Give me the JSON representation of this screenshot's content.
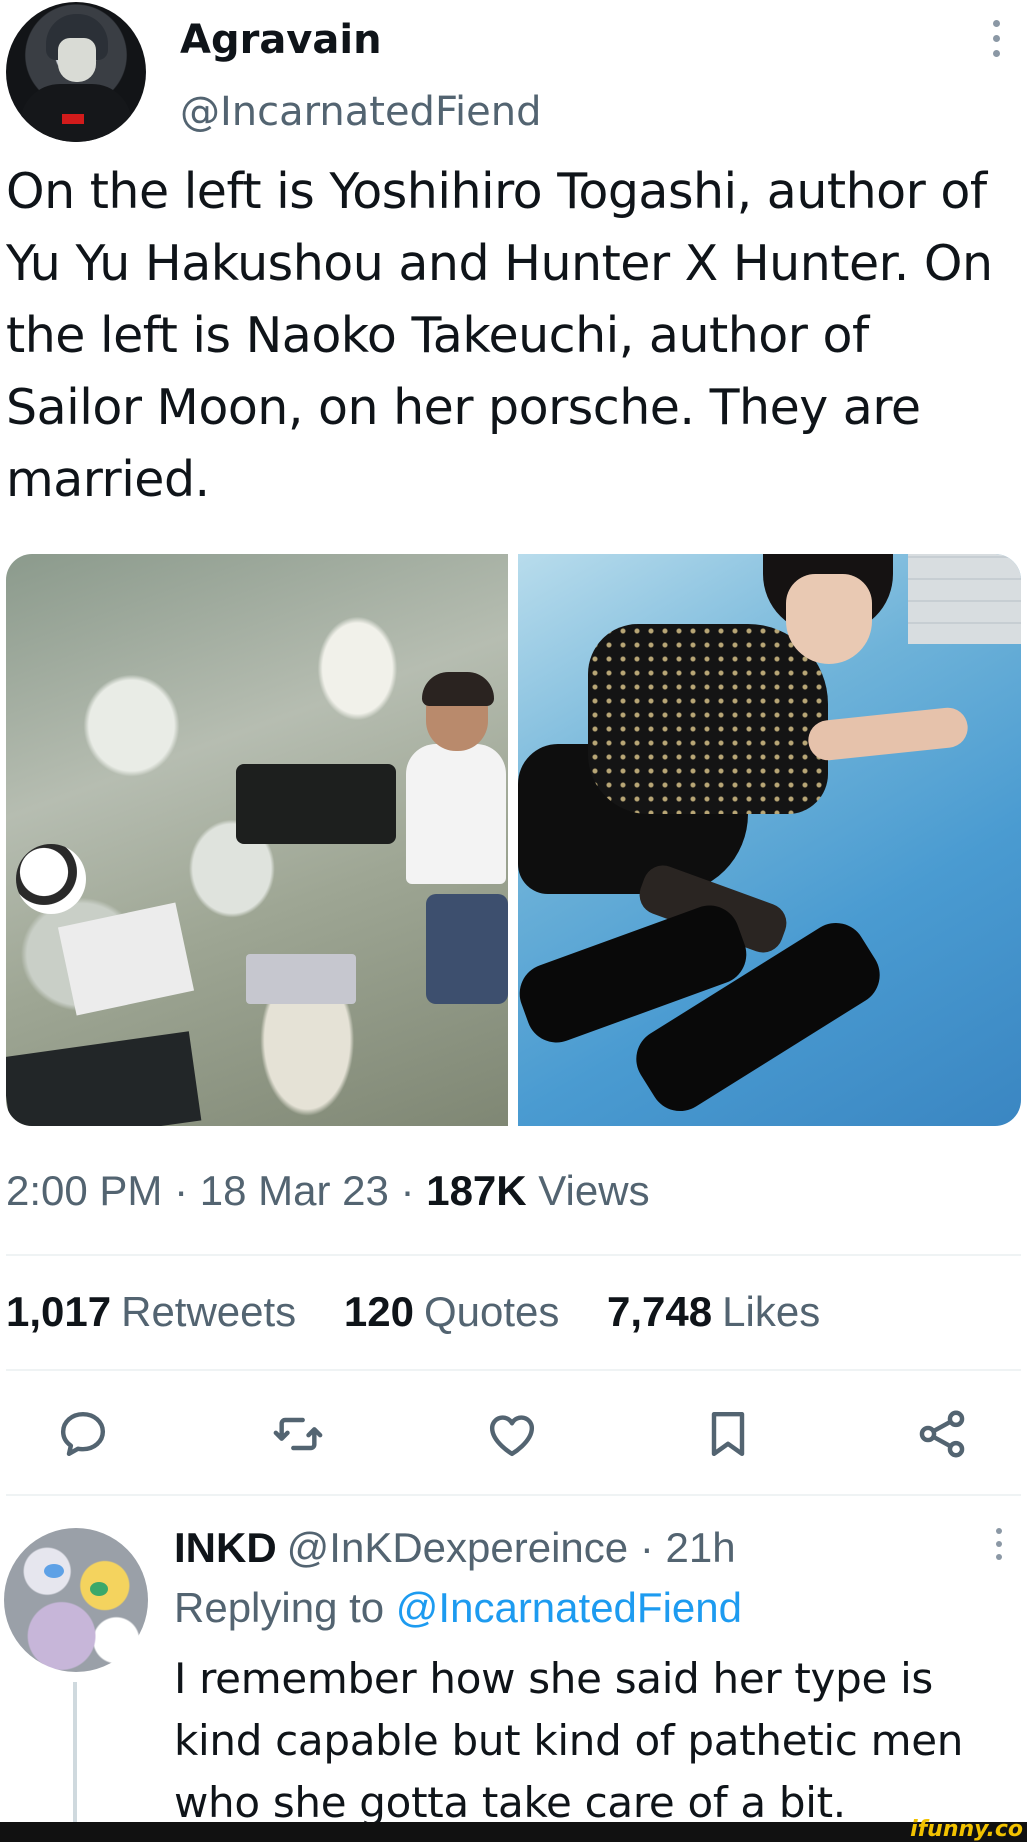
{
  "tweet": {
    "author": {
      "display_name": "Agravain",
      "handle": "@IncarnatedFiend"
    },
    "text": "On the left is Yoshihiro Togashi, author of Yu Yu Hakushou and Hunter X Hunter. On the left is Naoko Takeuchi, author of Sailor Moon, on her porsche. They are married.",
    "meta": {
      "time": "2:00 PM",
      "date": "18 Mar 23",
      "views_count": "187K",
      "views_label": "Views",
      "separator": "·"
    },
    "stats": {
      "retweets_count": "1,017",
      "retweets_label": "Retweets",
      "quotes_count": "120",
      "quotes_label": "Quotes",
      "likes_count": "7,748",
      "likes_label": "Likes"
    },
    "actions": [
      "reply-icon",
      "retweet-icon",
      "like-icon",
      "bookmark-icon",
      "share-icon"
    ]
  },
  "reply": {
    "display_name": "INKD",
    "handle": "@InKDexpereince",
    "separator": "·",
    "age": "21h",
    "replying_prefix": "Replying to",
    "replying_to": "@IncarnatedFiend",
    "text": "I remember how she said her type is kind capable but kind of pathetic men who she gotta take care of a bit."
  },
  "watermark": "ifunny.co",
  "colors": {
    "secondary_text": "#536471",
    "link": "#1d9bf0",
    "divider": "#eff3f4",
    "primary_text": "#0f1419"
  }
}
